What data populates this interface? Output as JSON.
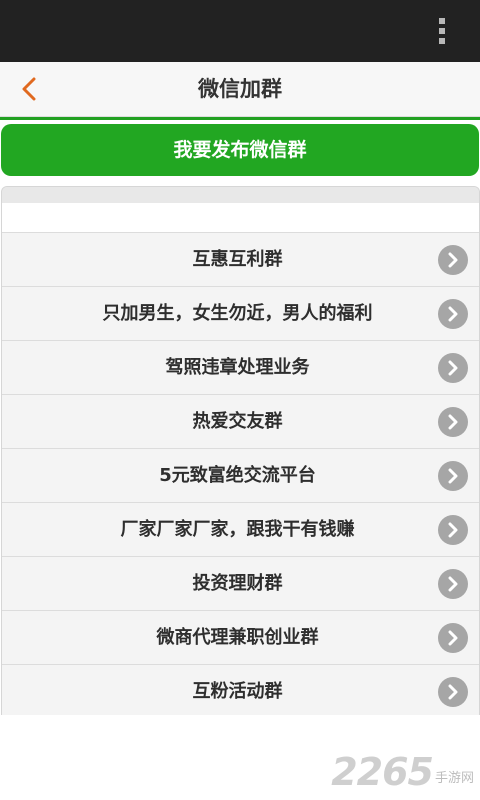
{
  "header": {
    "title": "微信加群"
  },
  "publish_button": {
    "label": "我要发布微信群"
  },
  "groups": [
    "互惠互利群",
    "只加男生，女生勿近，男人的福利",
    "驾照违章处理业务",
    "热爱交友群",
    "5元致富绝交流平台",
    "厂家厂家厂家，跟我干有钱赚",
    "投资理财群",
    "微商代理兼职创业群",
    "互粉活动群"
  ],
  "watermark": {
    "number": "2265",
    "text": "手游网"
  },
  "colors": {
    "accent_green": "#22a722",
    "back_arrow": "#e0691f",
    "status_bar": "#222222"
  },
  "icons": {
    "back": "chevron-left-icon",
    "row_arrow": "chevron-right-circle-icon",
    "overflow": "overflow-menu-icon"
  }
}
